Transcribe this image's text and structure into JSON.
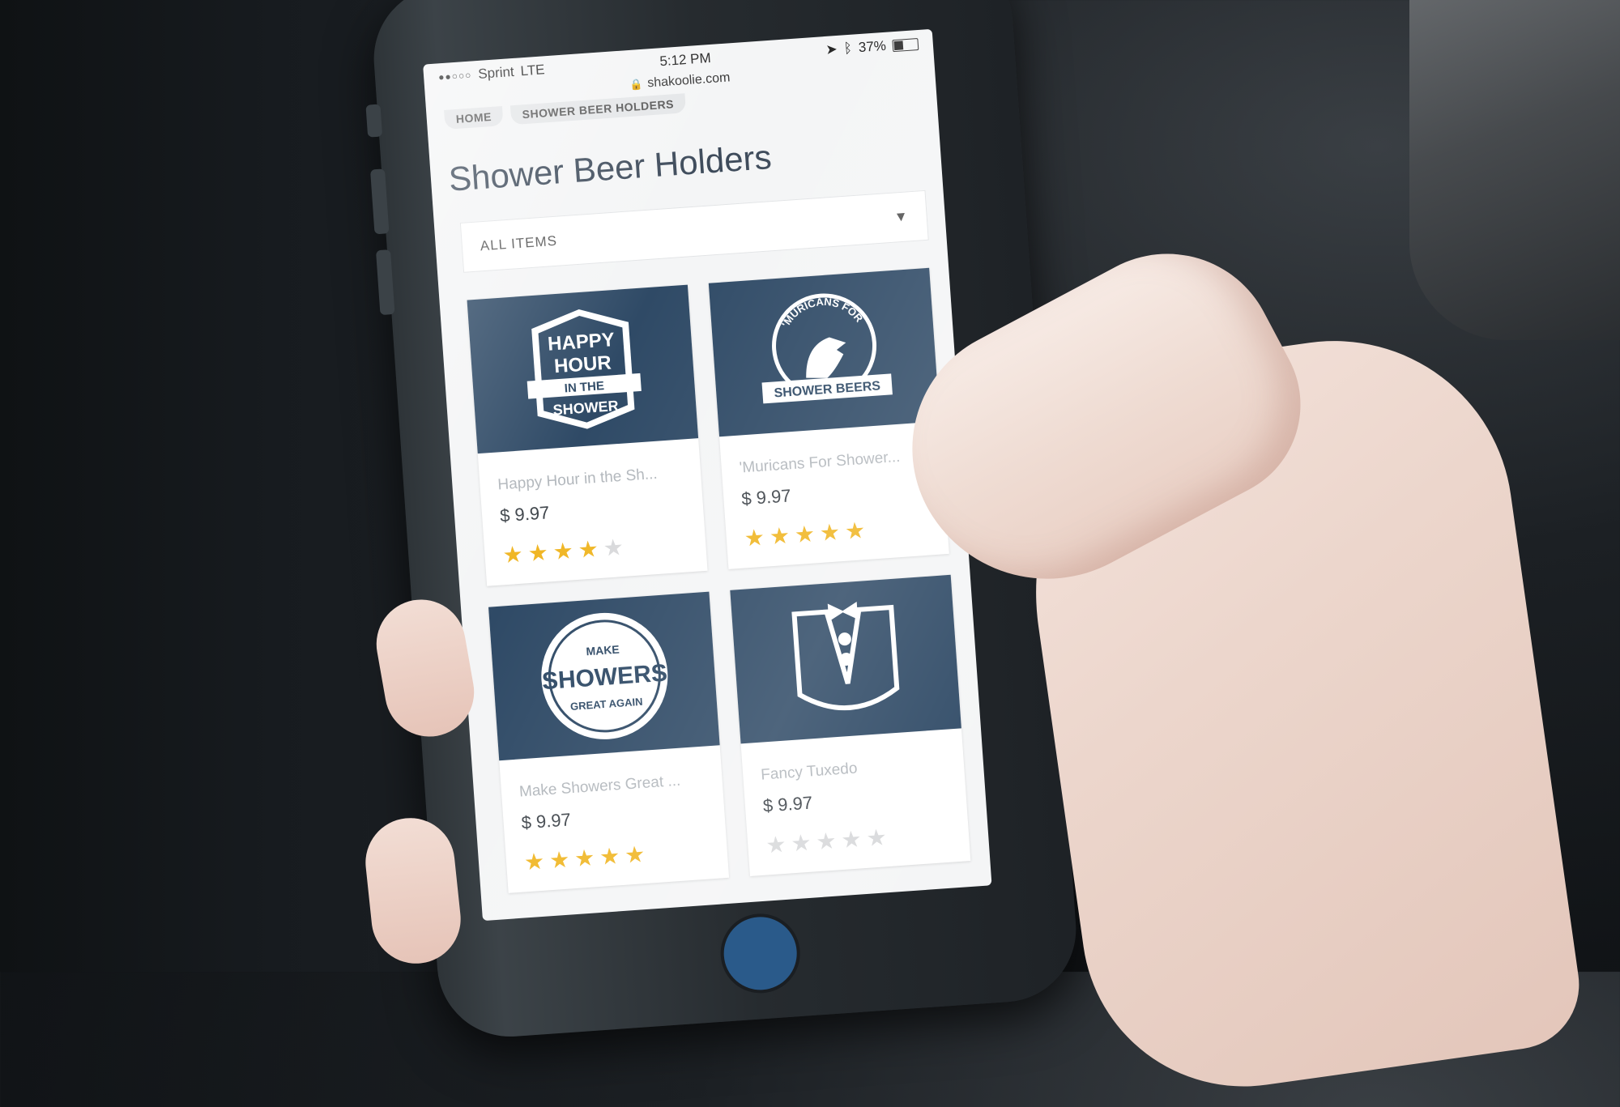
{
  "status_bar": {
    "carrier": "Sprint",
    "network": "LTE",
    "time": "5:12 PM",
    "battery": "37%"
  },
  "browser": {
    "url": "shakoolie.com"
  },
  "breadcrumb": [
    "HOME",
    "SHOWER BEER HOLDERS"
  ],
  "page": {
    "title": "Shower Beer Holders",
    "filter_label": "ALL ITEMS"
  },
  "products": [
    {
      "name": "Happy Hour in the Sh...",
      "price": "$ 9.97",
      "rating": 4,
      "art_lines": [
        "HAPPY",
        "HOUR",
        "IN THE",
        "SHOWER"
      ]
    },
    {
      "name": "'Muricans For Shower...",
      "price": "$ 9.97",
      "rating": 5,
      "art_lines": [
        "'MURICANS FOR",
        "SHOWER BEERS"
      ]
    },
    {
      "name": "Make Showers Great ...",
      "price": "$ 9.97",
      "rating": 5,
      "art_lines": [
        "MAKE",
        "SHOWERS",
        "GREAT AGAIN"
      ]
    },
    {
      "name": "Fancy Tuxedo",
      "price": "$ 9.97",
      "rating": 0,
      "art_lines": []
    }
  ],
  "colors": {
    "card_art_bg": "#2f4a66",
    "star": "#f0b624",
    "title": "#3d4a5a"
  }
}
